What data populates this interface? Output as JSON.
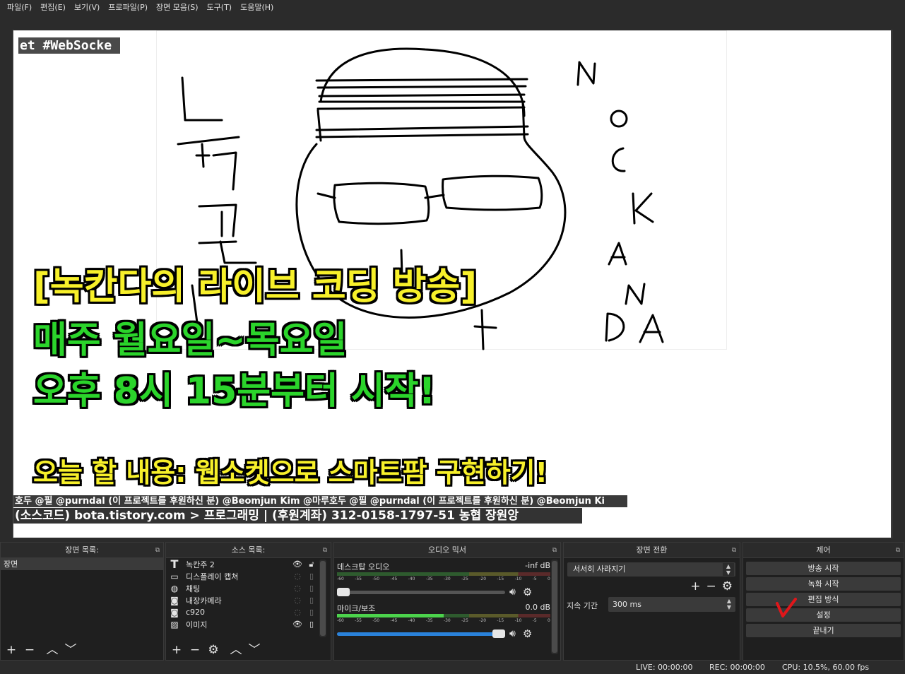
{
  "menu": [
    "파일(F)",
    "편집(E)",
    "보기(V)",
    "프로파일(P)",
    "장면 모음(S)",
    "도구(T)",
    "도움말(H)"
  ],
  "preview": {
    "ticker_top": "et #WebSocke",
    "title_line1": "[녹칸다의 라이브 코딩 방송]",
    "title_line2": "매주 월요일~목요일",
    "title_line3": "오후 8시 15분부터 시작!",
    "today_line": "오늘 할 내용: 웹소켓으로 스마트팜 구현하기!",
    "credits": "호두 @필 @purndal (이 프로젝트를 후원하신 분) @Beomjun Kim @마루호두 @필 @purndal (이 프로젝트를 후원하신 분) @Beomjun Ki",
    "source_line": "(소스코드) bota.tistory.com > 프로그래밍 | (후원계좌) 312-0158-1797-51 농협 장원앙",
    "drawing_text_left": [
      "노",
      "ㄱ",
      "칸",
      "ㄷ"
    ],
    "drawing_text_right": [
      "N",
      "O",
      "C",
      "K",
      "A",
      "N",
      "DA"
    ]
  },
  "docks": {
    "scenes": {
      "title": "장면 목록:",
      "items": [
        "장면"
      ]
    },
    "sources": {
      "title": "소스 목록:",
      "items": [
        {
          "name": "녹칸주 2",
          "icon": "text-icon",
          "visible": true
        },
        {
          "name": "디스플레이 캡쳐",
          "icon": "monitor-icon",
          "visible": false
        },
        {
          "name": "채팅",
          "icon": "globe-icon",
          "visible": false
        },
        {
          "name": "내장카메라",
          "icon": "camera-icon",
          "visible": false
        },
        {
          "name": "c920",
          "icon": "camera-icon",
          "visible": false
        },
        {
          "name": "이미지",
          "icon": "image-icon",
          "visible": true
        }
      ]
    },
    "mixer": {
      "title": "오디오 믹서",
      "scale": [
        "-60",
        "-55",
        "-50",
        "-45",
        "-40",
        "-35",
        "-30",
        "-25",
        "-20",
        "-15",
        "-10",
        "-5",
        "0"
      ],
      "channels": [
        {
          "name": "데스크탑 오디오",
          "level": "-inf dB",
          "meter": 0.0,
          "volume": 0.04
        },
        {
          "name": "마이크/보조",
          "level": "0.0 dB",
          "meter": 0.5,
          "volume": 1.0
        }
      ]
    },
    "transitions": {
      "title": "장면 전환",
      "selected": "서서히 사라지기",
      "duration_label": "지속 기간",
      "duration_value": "300 ms"
    },
    "controls": {
      "title": "제어",
      "buttons": [
        "방송 시작",
        "녹화 시작",
        "편집 방식",
        "설정",
        "끝내기"
      ]
    }
  },
  "status": {
    "live": "LIVE: 00:00:00",
    "rec": "REC: 00:00:00",
    "cpu": "CPU: 10.5%, 60.00 fps"
  },
  "colors": {
    "title_yellow": "#f7f02a",
    "title_green": "#2bd42b",
    "annotation_red": "#e0161a"
  }
}
